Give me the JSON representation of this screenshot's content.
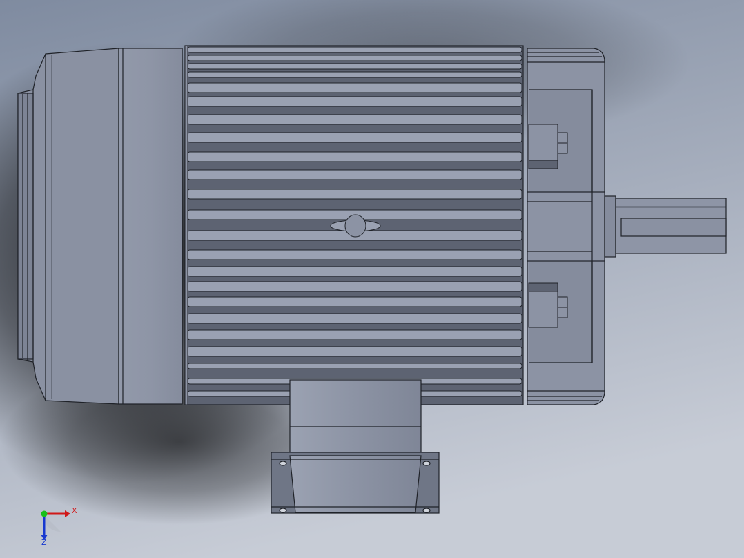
{
  "triad": {
    "x_label": "X",
    "z_label": "Z",
    "x_color": "#d01818",
    "y_color": "#18c018",
    "z_color": "#1838d0"
  },
  "model": {
    "body_color": "#8c93a4",
    "fin_color": "#9aa1b2",
    "groove_color": "#5d6372",
    "edge_color": "#1f2228",
    "background_top": "#8793a6",
    "background_bottom": "#c3c8d2"
  }
}
